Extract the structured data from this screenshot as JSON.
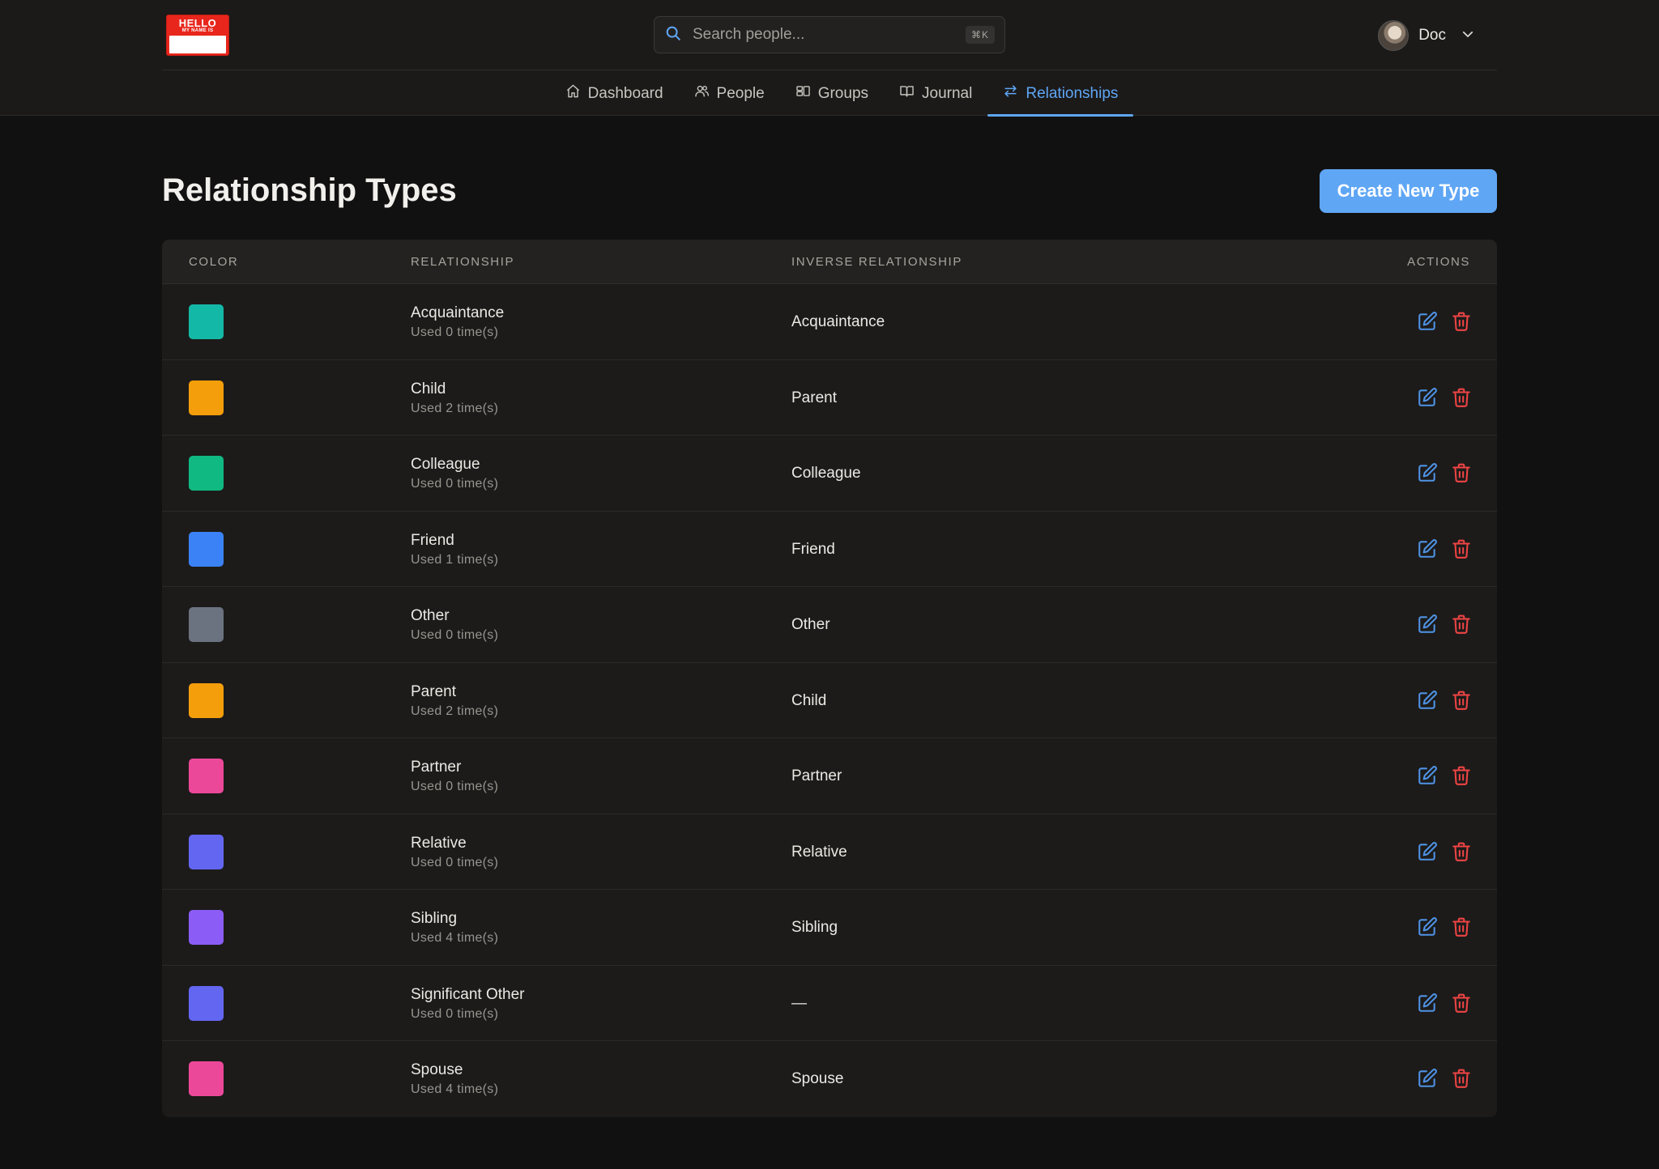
{
  "logo": {
    "line1": "HELLO",
    "line2": "MY NAME IS"
  },
  "search": {
    "placeholder": "Search people...",
    "shortcut": "⌘K"
  },
  "user": {
    "name": "Doc"
  },
  "nav": {
    "tabs": [
      {
        "label": "Dashboard",
        "icon": "home-icon"
      },
      {
        "label": "People",
        "icon": "users-icon"
      },
      {
        "label": "Groups",
        "icon": "groups-icon"
      },
      {
        "label": "Journal",
        "icon": "book-icon"
      },
      {
        "label": "Relationships",
        "icon": "arrows-icon",
        "active": true
      }
    ]
  },
  "page": {
    "title": "Relationship Types",
    "create_label": "Create New Type"
  },
  "table": {
    "headers": {
      "color": "COLOR",
      "relationship": "RELATIONSHIP",
      "inverse": "INVERSE RELATIONSHIP",
      "actions": "ACTIONS"
    },
    "rows": [
      {
        "color": "#14b8a6",
        "name": "Acquaintance",
        "used": "Used 0 time(s)",
        "inverse": "Acquaintance"
      },
      {
        "color": "#f59e0b",
        "name": "Child",
        "used": "Used 2 time(s)",
        "inverse": "Parent"
      },
      {
        "color": "#10b981",
        "name": "Colleague",
        "used": "Used 0 time(s)",
        "inverse": "Colleague"
      },
      {
        "color": "#3b82f6",
        "name": "Friend",
        "used": "Used 1 time(s)",
        "inverse": "Friend"
      },
      {
        "color": "#6b7280",
        "name": "Other",
        "used": "Used 0 time(s)",
        "inverse": "Other"
      },
      {
        "color": "#f59e0b",
        "name": "Parent",
        "used": "Used 2 time(s)",
        "inverse": "Child"
      },
      {
        "color": "#ec4899",
        "name": "Partner",
        "used": "Used 0 time(s)",
        "inverse": "Partner"
      },
      {
        "color": "#6366f1",
        "name": "Relative",
        "used": "Used 0 time(s)",
        "inverse": "Relative"
      },
      {
        "color": "#8b5cf6",
        "name": "Sibling",
        "used": "Used 4 time(s)",
        "inverse": "Sibling"
      },
      {
        "color": "#6366f1",
        "name": "Significant Other",
        "used": "Used 0 time(s)",
        "inverse": "—"
      },
      {
        "color": "#ec4899",
        "name": "Spouse",
        "used": "Used 4 time(s)",
        "inverse": "Spouse"
      }
    ]
  },
  "colors": {
    "accent": "#5fa6f5",
    "danger": "#ef4444",
    "edit": "#4f93e6"
  }
}
